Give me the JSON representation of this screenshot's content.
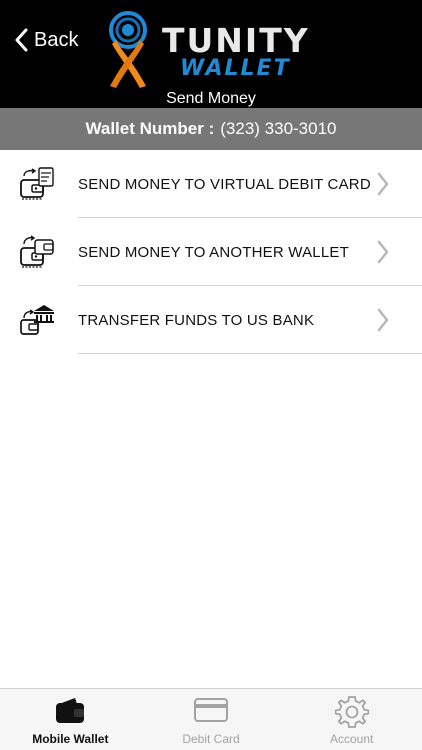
{
  "header": {
    "back_label": "Back",
    "logo_line1": "TUNITY",
    "logo_line2": "WALLET",
    "title": "Send Money"
  },
  "wallet": {
    "label": "Wallet Number :",
    "number": "(323) 330-3010"
  },
  "menu": {
    "items": [
      {
        "label": "SEND MONEY TO VIRTUAL DEBIT CARD",
        "icon": "wallet-to-card-icon"
      },
      {
        "label": "SEND MONEY TO ANOTHER WALLET",
        "icon": "wallet-to-wallet-icon"
      },
      {
        "label": "TRANSFER FUNDS TO US BANK",
        "icon": "bank-transfer-icon"
      }
    ]
  },
  "tabbar": {
    "tabs": [
      {
        "label": "Mobile Wallet",
        "icon": "wallet-icon",
        "active": true
      },
      {
        "label": "Debit Card",
        "icon": "credit-card-icon",
        "active": false
      },
      {
        "label": "Account",
        "icon": "gear-icon",
        "active": false
      }
    ]
  },
  "colors": {
    "header_bg": "#000000",
    "wallet_bar_bg": "#777777",
    "brand_blue": "#1e8ad8",
    "brand_orange": "#f08a1c",
    "tab_active": "#111111",
    "tab_inactive": "#a3a3a3"
  }
}
